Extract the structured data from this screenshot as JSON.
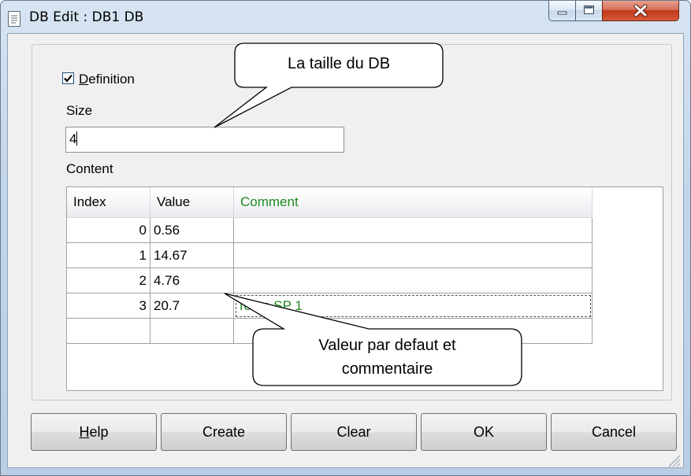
{
  "window": {
    "title": "DB Edit : DB1 DB"
  },
  "definition": {
    "checked": true,
    "label_prefix": "D",
    "label_rest": "efinition"
  },
  "size": {
    "label": "Size",
    "value": "4"
  },
  "content": {
    "label": "Content",
    "columns": [
      "Index",
      "Value",
      "Comment"
    ],
    "rows": [
      {
        "index": "0",
        "value": "0.56",
        "comment": ""
      },
      {
        "index": "1",
        "value": "14.67",
        "comment": ""
      },
      {
        "index": "2",
        "value": "4.76",
        "comment": ""
      },
      {
        "index": "3",
        "value": "20.7",
        "comment": "Temp SP 1"
      },
      {
        "index": "",
        "value": "",
        "comment": ""
      }
    ]
  },
  "buttons": {
    "help_prefix": "H",
    "help_rest": "elp",
    "create": "Create",
    "clear": "Clear",
    "ok": "OK",
    "cancel": "Cancel"
  },
  "annotations": {
    "size_callout": "La taille du DB",
    "content_callout_line1": "Valeur par defaut et",
    "content_callout_line2": "commentaire"
  },
  "colors": {
    "comment_text": "#1f8a1f",
    "close_button": "#c2391b"
  }
}
